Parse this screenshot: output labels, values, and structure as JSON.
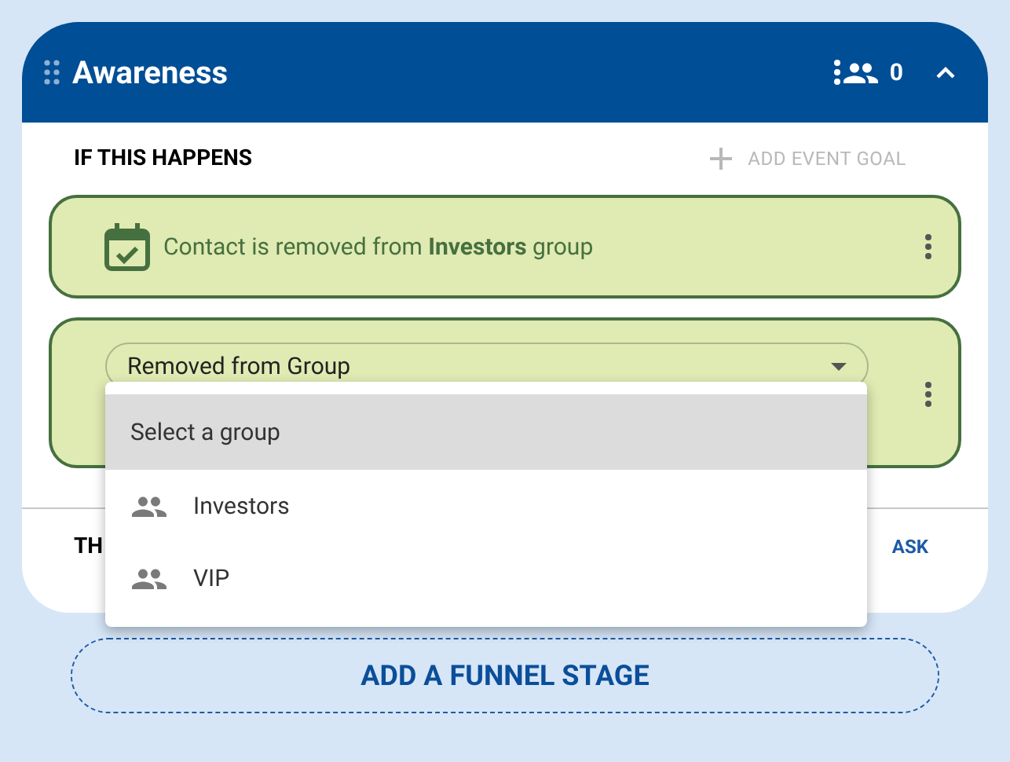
{
  "stage": {
    "title": "Awareness",
    "contacts": "0",
    "expanded": true
  },
  "trigger_section": {
    "heading": "IF THIS HAPPENS",
    "add_button": "ADD EVENT GOAL"
  },
  "events": [
    {
      "kind": "summary",
      "text": "Contact is removed from **Investors** group"
    },
    {
      "kind": "editor",
      "select_value": "Removed from Group"
    }
  ],
  "dropdown": {
    "options": [
      {
        "kind": "prompt",
        "label": "Select a group",
        "selected": true
      },
      {
        "kind": "group",
        "label": "Investors",
        "selected": false
      },
      {
        "kind": "group",
        "label": "VIP",
        "selected": false
      }
    ]
  },
  "action_section": {
    "heading": "TH",
    "add_button": "ASK"
  },
  "add_stage_button": "ADD A FUNNEL STAGE"
}
